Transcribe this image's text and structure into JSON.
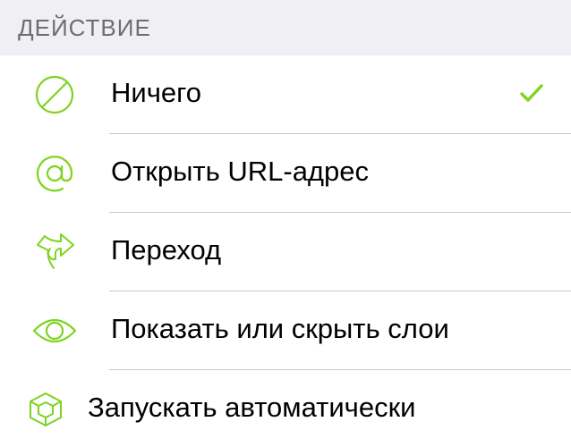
{
  "section": {
    "title": "ДЕЙСТВИЕ"
  },
  "colors": {
    "accent": "#7ed321",
    "header_bg": "#efeff4",
    "header_text": "#6d6d72",
    "separator": "#c8c7cc"
  },
  "actions": [
    {
      "label": "Ничего",
      "icon": "none-icon",
      "selected": true
    },
    {
      "label": "Открыть URL-адрес",
      "icon": "at-sign-icon",
      "selected": false
    },
    {
      "label": "Переход",
      "icon": "jump-arrow-icon",
      "selected": false
    },
    {
      "label": "Показать или скрыть слои",
      "icon": "eye-icon",
      "selected": false
    }
  ],
  "auto_run": {
    "label": "Запускать автоматически",
    "icon": "auto-run-cube-icon"
  }
}
